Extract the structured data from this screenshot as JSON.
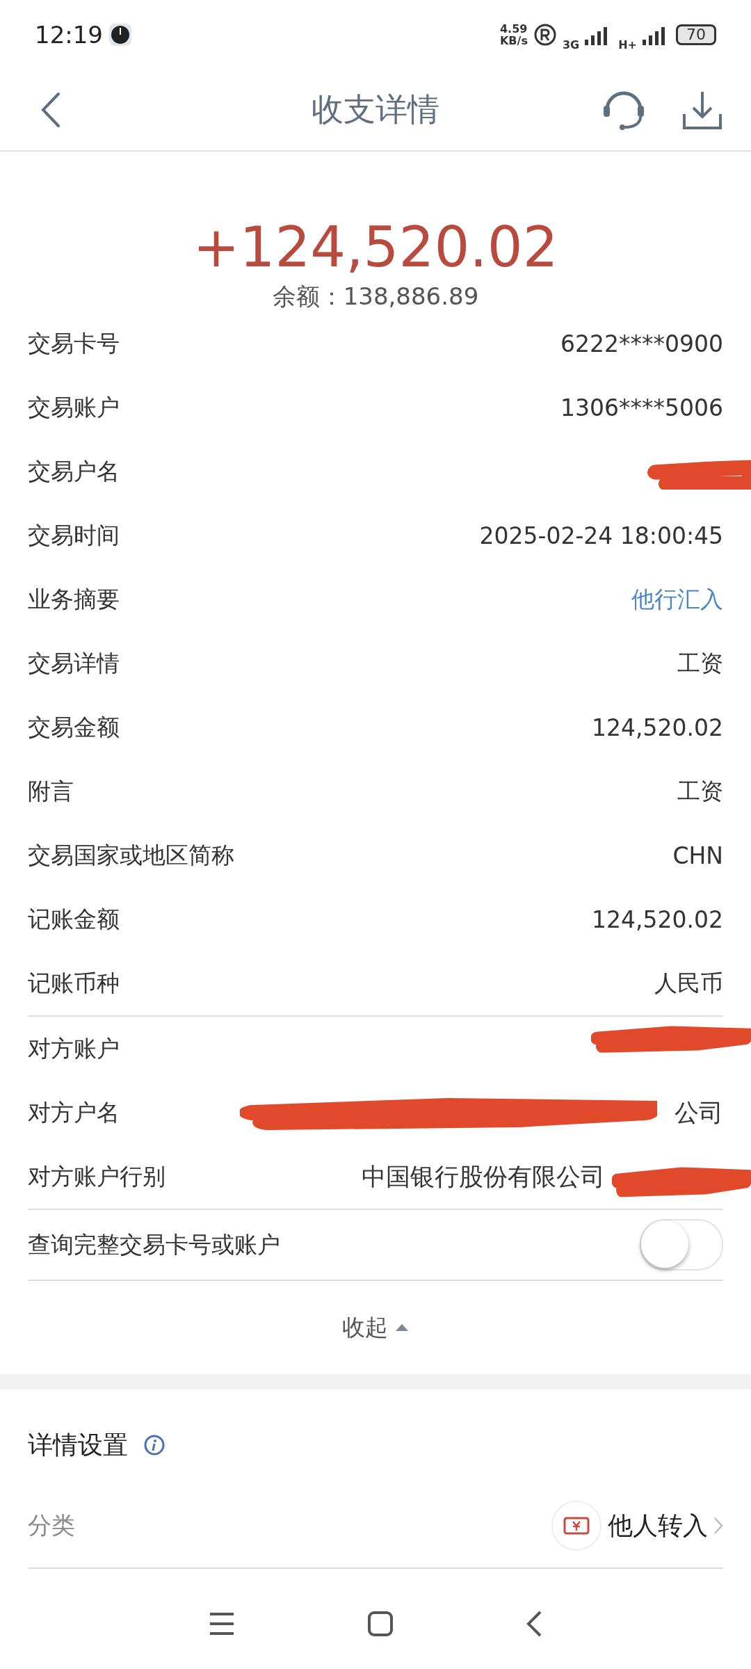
{
  "status_bar": {
    "time": "12:19",
    "speed_value": "4.59",
    "speed_unit": "KB/s",
    "network_1": "3G",
    "network_2": "H+",
    "battery": "70"
  },
  "header": {
    "title": "收支详情"
  },
  "amount": "+124,520.02",
  "balance": "余额：138,886.89",
  "details": [
    {
      "label": "交易卡号",
      "value": "6222****0900",
      "kind": "plain"
    },
    {
      "label": "交易账户",
      "value": "1306****5006",
      "kind": "plain"
    },
    {
      "label": "交易户名",
      "kind": "redacted"
    },
    {
      "label": "交易时间",
      "value": "2025-02-24 18:00:45",
      "kind": "plain"
    },
    {
      "label": "业务摘要",
      "value": "他行汇入",
      "kind": "link"
    },
    {
      "label": "交易详情",
      "value": "工资",
      "kind": "plain"
    },
    {
      "label": "交易金额",
      "value": "124,520.02",
      "kind": "plain"
    },
    {
      "label": "附言",
      "value": "工资",
      "kind": "plain"
    },
    {
      "label": "交易国家或地区简称",
      "value": "CHN",
      "kind": "plain"
    },
    {
      "label": "记账金额",
      "value": "124,520.02",
      "kind": "plain"
    },
    {
      "label": "记账币种",
      "value": "人民币",
      "kind": "plain"
    }
  ],
  "counterparty": [
    {
      "label": "对方账户",
      "kind": "redacted"
    },
    {
      "label": "对方户名",
      "value": "公司",
      "kind": "redacted"
    },
    {
      "label": "对方账户行别",
      "value": "中国银行股份有限公司",
      "kind": "redacted"
    }
  ],
  "full_number_toggle": {
    "label": "查询完整交易卡号或账户",
    "on": false
  },
  "collapse": "收起",
  "settings": {
    "title": "详情设置",
    "category_label": "分类",
    "category_value": "他人转入"
  }
}
